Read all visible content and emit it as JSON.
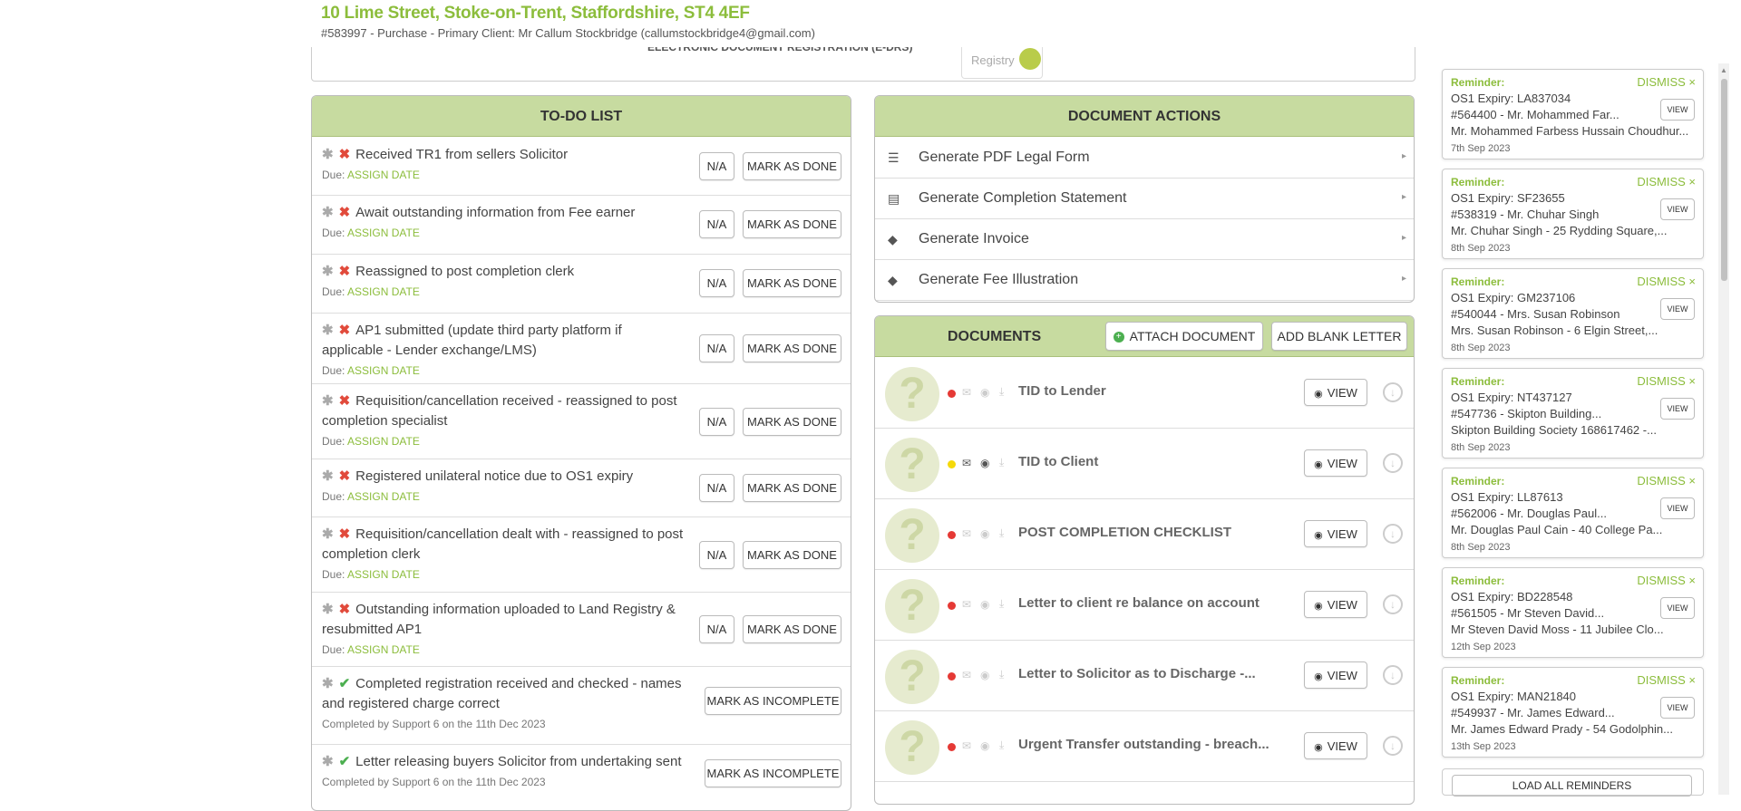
{
  "header": {
    "address": "10 Lime Street, Stoke-on-Trent, Staffordshire, ST4 4EF",
    "subtitle": "#583997 - Purchase - Primary Client: Mr Callum Stockbridge (callumstockbridge4@gmail.com)"
  },
  "topcard": {
    "edr_label": "ELECTRONIC DOCUMENT REGISTRATION (E-DRS)",
    "registry_label": "Registry"
  },
  "todo": {
    "title": "TO-DO LIST",
    "na_label": "N/A",
    "done_label": "MARK AS DONE",
    "incomplete_label": "MARK AS INCOMPLETE",
    "due_prefix": "Due:",
    "assign_label": "ASSIGN DATE",
    "items": [
      {
        "text": "Received TR1 from sellers Solicitor",
        "status": "open"
      },
      {
        "text": "Await outstanding information from Fee earner",
        "status": "open"
      },
      {
        "text": "Reassigned to post completion clerk",
        "status": "open"
      },
      {
        "text1": "AP1 submitted (update third party platform if",
        "text2": "applicable - Lender exchange/LMS)",
        "status": "open"
      },
      {
        "text1": "Requisition/cancellation received - reassigned to post",
        "text2": "completion specialist",
        "status": "open"
      },
      {
        "text": "Registered unilateral notice due to OS1 expiry",
        "status": "open"
      },
      {
        "text1": "Requisition/cancellation dealt with - reassigned to post",
        "text2": "completion clerk",
        "status": "open"
      },
      {
        "text1": "Outstanding information uploaded to Land Registry &",
        "text2": "resubmitted AP1",
        "status": "open"
      },
      {
        "text1": "Completed registration received and checked - names",
        "text2": "and registered charge correct",
        "completed": "Completed by Support 6 on the 11th Dec 2023",
        "status": "done"
      },
      {
        "text": "Letter releasing buyers Solicitor from undertaking sent",
        "completed": "Completed by Support 6 on the 11th Dec 2023",
        "status": "done"
      }
    ]
  },
  "doc_actions": {
    "title": "DOCUMENT ACTIONS",
    "items": [
      {
        "label": "Generate PDF Legal Form",
        "icon": "indent-list-icon"
      },
      {
        "label": "Generate Completion Statement",
        "icon": "statement-icon"
      },
      {
        "label": "Generate Invoice",
        "icon": "tag-icon"
      },
      {
        "label": "Generate Fee Illustration",
        "icon": "tag-icon"
      }
    ]
  },
  "documents": {
    "title": "DOCUMENTS",
    "attach_label": "ATTACH DOCUMENT",
    "blank_letter_label": "ADD BLANK LETTER",
    "view_label": "VIEW",
    "items": [
      {
        "name": "TID to Lender",
        "dot": "#e53935",
        "sent": false
      },
      {
        "name": "TID to Client",
        "dot": "#f5d90a",
        "sent": true
      },
      {
        "name": "POST COMPLETION CHECKLIST",
        "dot": "#e53935",
        "sent": false
      },
      {
        "name": "Letter to client re balance on account",
        "dot": "#e53935",
        "sent": false
      },
      {
        "name": "Letter to Solicitor as to Discharge -...",
        "dot": "#e53935",
        "sent": false
      },
      {
        "name": "Urgent Transfer outstanding - breach...",
        "dot": "#e53935",
        "sent": false
      }
    ]
  },
  "reminders": {
    "title": "Reminder:",
    "dismiss_label": "DISMISS ×",
    "view_label": "VIEW",
    "load_all_label": "LOAD ALL REMINDERS",
    "items": [
      {
        "l1": "OS1 Expiry: LA837034",
        "l2": "#564400 - Mr. Mohammed Far...",
        "l3": "Mr. Mohammed Farbess Hussain Choudhur...",
        "date": "7th Sep 2023"
      },
      {
        "l1": "OS1 Expiry: SF23655",
        "l2": "#538319 - Mr. Chuhar Singh",
        "l3": "Mr. Chuhar Singh - 25 Rydding Square,...",
        "date": "8th Sep 2023"
      },
      {
        "l1": "OS1 Expiry: GM237106",
        "l2": "#540044 - Mrs. Susan Robinson",
        "l3": "Mrs. Susan Robinson - 6 Elgin Street,...",
        "date": "8th Sep 2023"
      },
      {
        "l1": "OS1 Expiry: NT437127",
        "l2": "#547736 - Skipton Building...",
        "l3": "Skipton Building Society 168617462 -...",
        "date": "8th Sep 2023"
      },
      {
        "l1": "OS1 Expiry: LL87613",
        "l2": "#562006 - Mr. Douglas Paul...",
        "l3": "Mr. Douglas Paul Cain - 40 College Pa...",
        "date": "8th Sep 2023"
      },
      {
        "l1": "OS1 Expiry: BD228548",
        "l2": "#561505 - Mr Steven David...",
        "l3": "Mr Steven David Moss - 11 Jubilee Clo...",
        "date": "12th Sep 2023"
      },
      {
        "l1": "OS1 Expiry: MAN21840",
        "l2": "#549937 - Mr. James Edward...",
        "l3": "Mr. James Edward Prady - 54 Godolphin...",
        "date": "13th Sep 2023"
      }
    ]
  }
}
